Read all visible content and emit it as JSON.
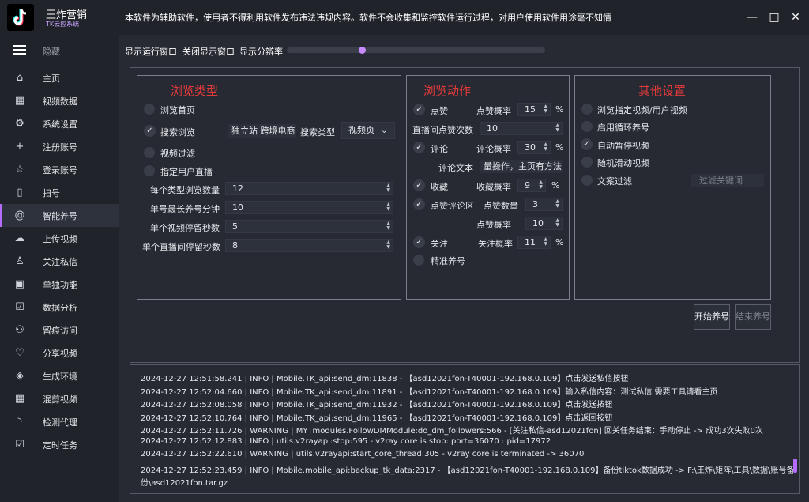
{
  "app": {
    "name": "王炸营销",
    "subtitle": "TK云控系统"
  },
  "notice": "本软件为辅助软件，使用者不得利用软件发布违法违规内容。软件不会收集和监控软件运行过程，对用户使用软件用途毫不知情",
  "window": {
    "minimize": "—",
    "maximize": "□",
    "close": "✕"
  },
  "sidebar": {
    "hide_label": "隐藏",
    "items": [
      {
        "icon": "home-icon",
        "glyph": "⌂",
        "label": "主页"
      },
      {
        "icon": "film-icon",
        "glyph": "▦",
        "label": "视频数据"
      },
      {
        "icon": "gear-icon",
        "glyph": "⚙",
        "label": "系统设置"
      },
      {
        "icon": "plus-icon",
        "glyph": "+",
        "label": "注册账号"
      },
      {
        "icon": "star-icon",
        "glyph": "☆",
        "label": "登录账号"
      },
      {
        "icon": "phone-icon",
        "glyph": "▯",
        "label": "扫号"
      },
      {
        "icon": "at-icon",
        "glyph": "@",
        "label": "智能养号",
        "active": true
      },
      {
        "icon": "upload-cloud-icon",
        "glyph": "☁",
        "label": "上传视频"
      },
      {
        "icon": "user-add-icon",
        "glyph": "♙",
        "label": "关注私信"
      },
      {
        "icon": "nk-icon",
        "glyph": "▣",
        "label": "单独功能"
      },
      {
        "icon": "chart-icon",
        "glyph": "☑",
        "label": "数据分析"
      },
      {
        "icon": "users-icon",
        "glyph": "⚇",
        "label": "留痕访问"
      },
      {
        "icon": "heart-icon",
        "glyph": "♡",
        "label": "分享视频"
      },
      {
        "icon": "layers-icon",
        "glyph": "◈",
        "label": "生成环境"
      },
      {
        "icon": "film-strip-icon",
        "glyph": "▦",
        "label": "混剪视频"
      },
      {
        "icon": "rss-icon",
        "glyph": "◝",
        "label": "检测代理"
      },
      {
        "icon": "task-icon",
        "glyph": "☑",
        "label": "定时任务"
      }
    ]
  },
  "toolbar": {
    "show_window": "显示运行窗口",
    "hide_window": "关闭显示窗口",
    "resolution": "显示分辨率",
    "resolution_level": 0.29
  },
  "browse_type": {
    "title": "浏览类型",
    "browse_home": "浏览首页",
    "search_browse": "搜索浏览",
    "search_keyword": "独立站 跨境电商",
    "search_type_label": "搜索类型",
    "search_type_value": "视频页",
    "video_filter": "视频过滤",
    "specified_live": "指定用户直播",
    "fields": [
      {
        "label": "每个类型浏览数量",
        "value": "12"
      },
      {
        "label": "单号最长养号分钟",
        "value": "10"
      },
      {
        "label": "单个视频停留秒数",
        "value": "5"
      },
      {
        "label": "单个直播间停留秒数",
        "value": "8"
      }
    ]
  },
  "browse_action": {
    "title": "浏览动作",
    "like": "点赞",
    "like_rate_label": "点赞概率",
    "like_rate": "15",
    "live_like_label": "直播间点赞次数",
    "live_like": "10",
    "comment": "评论",
    "comment_rate_label": "评论概率",
    "comment_rate": "30",
    "comment_text_label": "评论文本",
    "comment_text": "量操作，主页有方法",
    "favorite": "收藏",
    "favorite_rate_label": "收藏概率",
    "favorite_rate": "9",
    "like_comment": "点赞评论区",
    "like_count_label": "点赞数量",
    "like_count": "3",
    "like_rate2_label": "点赞概率",
    "like_rate2": "10",
    "follow": "关注",
    "follow_rate_label": "关注概率",
    "follow_rate": "11",
    "precise": "精准养号",
    "percent": "%"
  },
  "other": {
    "title": "其他设置",
    "specified_video": "浏览指定视频/用户视频",
    "loop": "启用循环养号",
    "auto_pause": "自动暂停视频",
    "random_swipe": "随机滑动视频",
    "text_filter": "文案过滤",
    "filter_placeholder": "过滤关键词"
  },
  "buttons": {
    "start": "开始养号",
    "stop": "结束养号"
  },
  "log": [
    "2024-12-27 12:51:58.241 | INFO    | Mobile.TK_api:send_dm:11838 - 【asd12021fon-T40001-192.168.0.109】点击发送私信按钮",
    "2024-12-27 12:52:04.660 | INFO    | Mobile.TK_api:send_dm:11891 - 【asd12021fon-T40001-192.168.0.109】输入私信内容：测试私信 需要工具请看主页",
    "2024-12-27 12:52:08.058 | INFO    | Mobile.TK_api:send_dm:11932 - 【asd12021fon-T40001-192.168.0.109】点击发送按钮",
    "2024-12-27 12:52:10.764 | INFO    | Mobile.TK_api:send_dm:11965 - 【asd12021fon-T40001-192.168.0.109】点击返回按钮",
    "2024-12-27 12:52:11.726 | WARNING | MYTmodules.FollowDMModule:do_dm_followers:566 - [关注私信-asd12021fon] 回关任务结束：手动停止 -> 成功3次失败0次",
    "2024-12-27 12:52:12.883 | INFO    | utils.v2rayapi:stop:595 - v2ray core is stop: port=36070 : pid=17972",
    "2024-12-27 12:52:22.610 | WARNING | utils.v2rayapi:start_core_thread:305 - v2ray core is terminated -> 36070",
    "2024-12-27 12:52:23.459 | INFO    | Mobile.mobile_api:backup_tk_data:2317 - 【asd12021fon-T40001-192.168.0.109】备份tiktok数据成功 -> F:\\王炸\\矩阵\\工具\\数据\\账号备",
    "份\\asd12021fon.tar.gz"
  ],
  "colors": {
    "accent": "#b46bff",
    "section_title": "#e33a3a",
    "bg": "#272a33",
    "sidebar_bg": "#20232a"
  }
}
